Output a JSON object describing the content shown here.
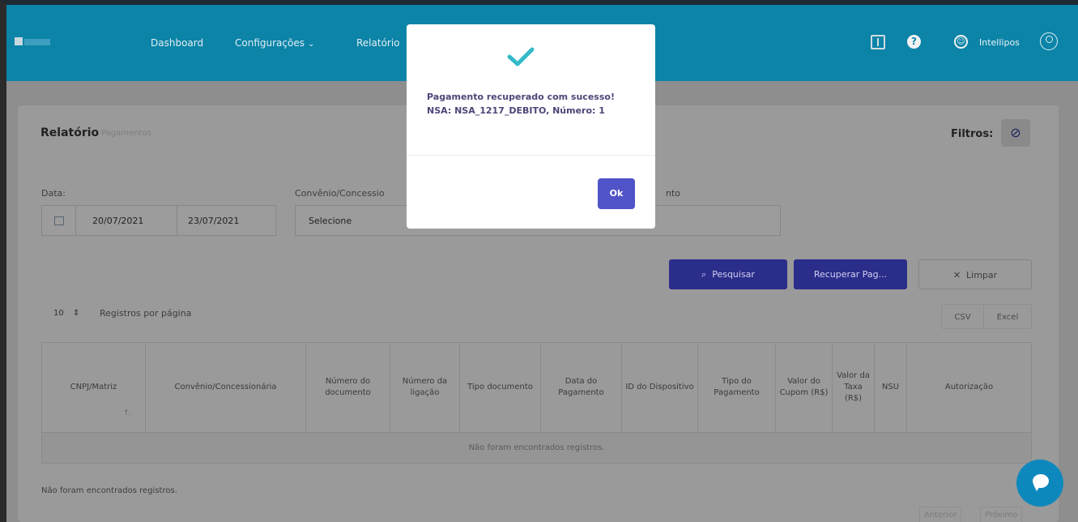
{
  "nav": {
    "dashboard": "Dashboard",
    "configuracoes": "Configurações",
    "relatorio": "Relatório",
    "user": "Intellipos"
  },
  "page": {
    "title": "Relatório",
    "subtitle": "Pagamentos",
    "filters_label": "Filtros:"
  },
  "form": {
    "date_label": "Data:",
    "date_from": "20/07/2021",
    "date_to": "23/07/2021",
    "convenio_label": "Convênio/Concessio",
    "tipo_label_partial": "nto",
    "select_placeholder": "Selecione"
  },
  "actions": {
    "search": "Pesquisar",
    "recover": "Recuperar Pag...",
    "clear": "Limpar"
  },
  "table_controls": {
    "per_page_value": "10",
    "per_page_label": "Registros por página",
    "csv": "CSV",
    "excel": "Excel"
  },
  "table": {
    "columns": [
      "CNPJ/Matriz",
      "Convênio/Concessionária",
      "Número do documento",
      "Número da ligação",
      "Tipo documento",
      "Data do Pagamento",
      "ID do Dispositivo",
      "Tipo do Pagamento",
      "Valor do Cupom (R$)",
      "Valor da Taxa (R$)",
      "NSU",
      "Autorização"
    ],
    "empty_message": "Não foram encontrados registros."
  },
  "footer": {
    "empty_message": "Não foram encontrados registros.",
    "prev": "Anterior",
    "next": "Próximo"
  },
  "modal": {
    "message": "Pagamento recuperado com sucesso! NSA: NSA_1217_DEBITO, Número: 1",
    "ok": "Ok"
  },
  "colors": {
    "topbar": "#0b84a8",
    "primary_button": "#2b2d8a",
    "modal_button": "#5054c8",
    "check": "#33b9c8"
  }
}
